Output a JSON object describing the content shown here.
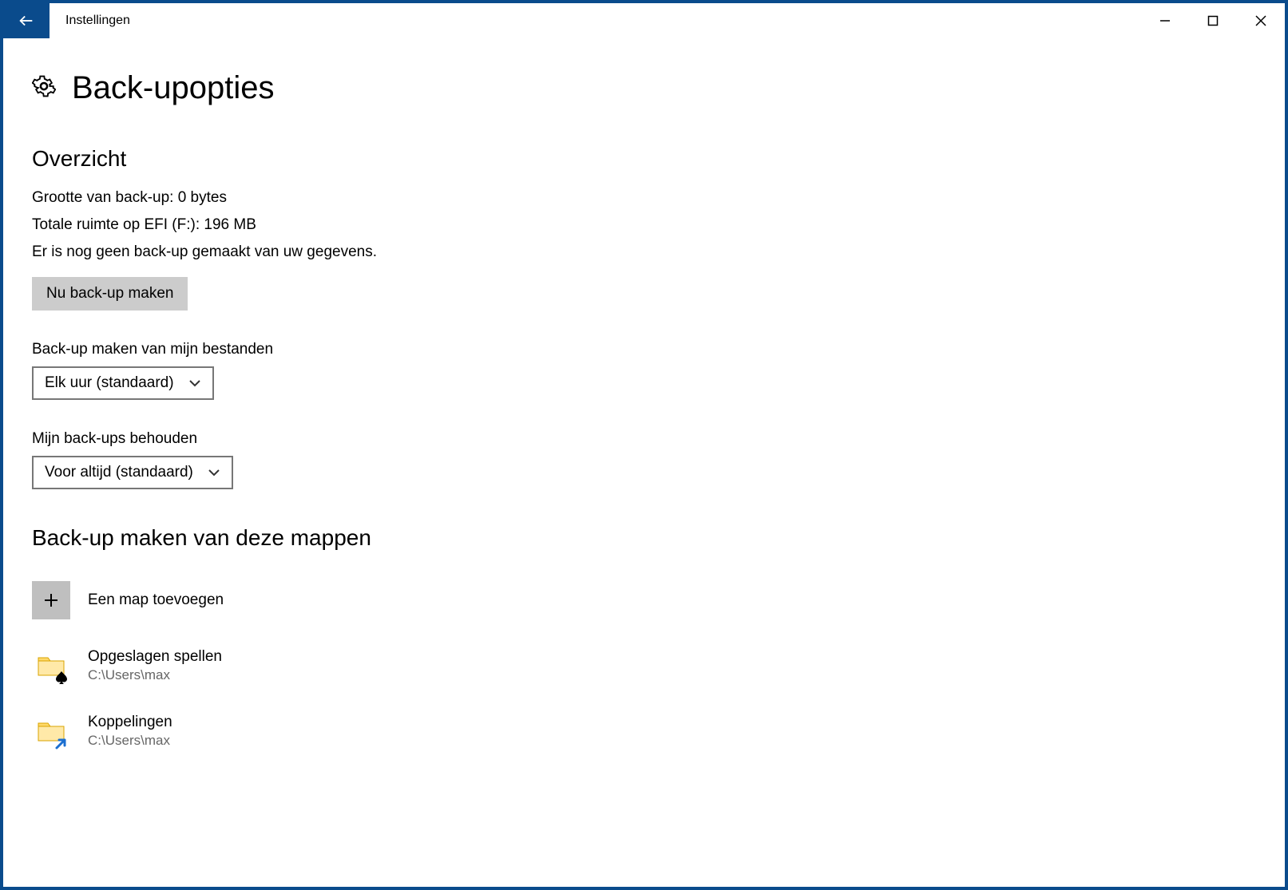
{
  "window": {
    "title": "Instellingen"
  },
  "page": {
    "title": "Back-upopties"
  },
  "overview": {
    "heading": "Overzicht",
    "backup_size": "Grootte van back-up: 0 bytes",
    "total_space": "Totale ruimte op EFI (F:): 196 MB",
    "status": "Er is nog geen back-up gemaakt van uw gegevens.",
    "backup_now_label": "Nu back-up maken"
  },
  "schedule": {
    "label": "Back-up maken van mijn bestanden",
    "selected": "Elk uur (standaard)"
  },
  "retention": {
    "label": "Mijn back-ups behouden",
    "selected": "Voor altijd (standaard)"
  },
  "folders": {
    "heading": "Back-up maken van deze mappen",
    "add_label": "Een map toevoegen",
    "items": [
      {
        "name": "Opgeslagen spellen",
        "path": "C:\\Users\\max",
        "icon": "games"
      },
      {
        "name": "Koppelingen",
        "path": "C:\\Users\\max",
        "icon": "links"
      }
    ]
  }
}
